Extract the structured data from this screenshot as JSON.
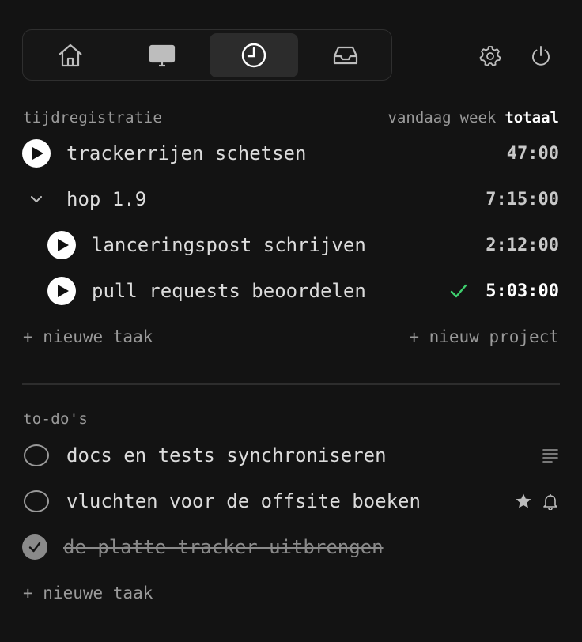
{
  "nav": {
    "tabs": [
      {
        "name": "home",
        "icon": "home-icon"
      },
      {
        "name": "screen",
        "icon": "monitor-icon"
      },
      {
        "name": "time",
        "icon": "clock-icon",
        "active": true
      },
      {
        "name": "inbox",
        "icon": "inbox-icon"
      }
    ],
    "settings_icon": "gear-icon",
    "power_icon": "power-icon"
  },
  "time_tracking": {
    "heading": "tijdregistratie",
    "ranges": [
      "vandaag",
      "week",
      "totaal"
    ],
    "selected_range": "totaal",
    "entries": [
      {
        "label": "trackerrijen schetsen",
        "time": "47:00"
      },
      {
        "label": "hop 1.9",
        "time": "7:15:00",
        "expanded": true
      },
      {
        "label": "lanceringspost schrijven",
        "time": "2:12:00"
      },
      {
        "label": "pull requests beoordelen",
        "time": "5:03:00",
        "completed": true
      }
    ],
    "new_task": "+ nieuwe taak",
    "new_project": "+ nieuw project"
  },
  "todos": {
    "heading": "to-do's",
    "items": [
      {
        "label": "docs en tests synchroniseren",
        "done": false,
        "icons": [
          "notes-icon"
        ]
      },
      {
        "label": "vluchten voor de offsite boeken",
        "done": false,
        "icons": [
          "star-icon",
          "bell-icon"
        ]
      },
      {
        "label": "de platte tracker uitbrengen",
        "done": true,
        "icons": []
      }
    ],
    "new_task": "+ nieuwe taak"
  },
  "colors": {
    "background": "#131313",
    "text": "#dcdcdc",
    "muted": "#9a9a9a",
    "accent_green": "#3ecf6e"
  }
}
